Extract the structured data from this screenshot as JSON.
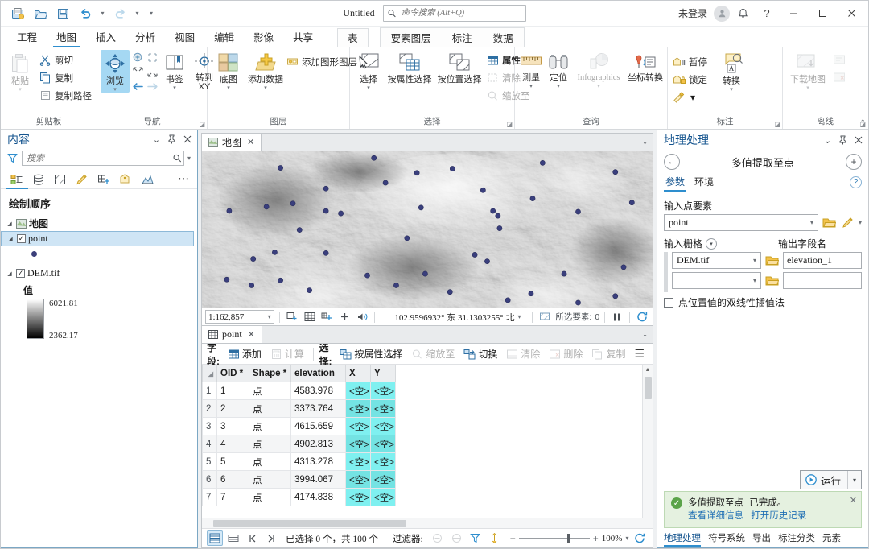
{
  "titlebar": {
    "project_title": "Untitled",
    "search_placeholder": "命令搜索 (Alt+Q)",
    "signin": "未登录",
    "qat": [
      "new-project-icon",
      "open-project-icon",
      "save-project-icon",
      "undo-icon",
      "redo-icon",
      "customize-qat-icon"
    ]
  },
  "ribbon_tabs": {
    "items": [
      {
        "label": "工程"
      },
      {
        "label": "地图"
      },
      {
        "label": "插入"
      },
      {
        "label": "分析"
      },
      {
        "label": "视图"
      },
      {
        "label": "编辑"
      },
      {
        "label": "影像"
      },
      {
        "label": "共享"
      }
    ],
    "active_index": 1,
    "contextual": [
      {
        "label": "表"
      },
      {
        "label": "要素图层"
      },
      {
        "label": "标注"
      },
      {
        "label": "数据"
      }
    ]
  },
  "ribbon": {
    "groups": [
      {
        "name": "剪贴板",
        "big": [
          {
            "label": "粘贴",
            "dropdown": true,
            "disabled": true
          }
        ],
        "small": [
          {
            "label": "剪切",
            "icon": "scissors-icon"
          },
          {
            "label": "复制",
            "icon": "copy-icon"
          },
          {
            "label": "复制路径",
            "icon": "copy-path-icon"
          }
        ]
      },
      {
        "name": "导航",
        "big": [
          {
            "label": "浏览",
            "dropdown": true,
            "selected": true
          },
          {
            "label": "书签",
            "dropdown": true
          },
          {
            "label": "转到",
            "label2": "XY"
          }
        ],
        "launcher": true
      },
      {
        "name": "图层",
        "big": [
          {
            "label": "底图",
            "dropdown": true
          },
          {
            "label": "添加数据",
            "dropdown": true
          }
        ],
        "small": [
          {
            "label": "添加图形图层",
            "icon": "graphics-layer-icon"
          }
        ]
      },
      {
        "name": "选择",
        "big": [
          {
            "label": "选择",
            "dropdown": true
          },
          {
            "label": "按属性选择"
          },
          {
            "label": "按位置选择"
          }
        ],
        "small": [
          {
            "label": "属性",
            "icon": "attributes-icon",
            "bold": true
          },
          {
            "label": "清除",
            "icon": "clear-selection-icon",
            "disabled": true
          },
          {
            "label": "缩放至",
            "icon": "zoom-to-selection-icon",
            "disabled": true
          }
        ],
        "launcher": true
      },
      {
        "name": "查询",
        "big": [
          {
            "label": "测量",
            "dropdown": true
          },
          {
            "label": "定位",
            "dropdown": true
          },
          {
            "label": "Infographics",
            "dropdown": true,
            "disabled": true
          },
          {
            "label": "坐标转换"
          }
        ]
      },
      {
        "name": "标注",
        "big": [
          {
            "label": "转换",
            "dropdown": true
          }
        ],
        "small": [
          {
            "label": "暂停",
            "icon": "pause-labeling-icon"
          },
          {
            "label": "锁定",
            "icon": "lock-labeling-icon"
          },
          {
            "label": "",
            "icon": "more-labeling-icon"
          }
        ],
        "launcher": true
      },
      {
        "name": "离线",
        "big": [
          {
            "label": "下载地图",
            "dropdown": true,
            "disabled": true
          }
        ],
        "launcher": true
      }
    ]
  },
  "contents": {
    "title": "内容",
    "search_placeholder": "搜索",
    "tabs": [
      "list-by-drawing-order-icon",
      "list-by-data-source-icon",
      "list-by-selection-icon",
      "list-by-editing-icon",
      "list-by-snapping-icon",
      "list-by-labeling-icon",
      "list-by-diagram-icon"
    ],
    "active_tab": 0,
    "heading": "绘制顺序",
    "tree": {
      "map_label": "地图",
      "layers": [
        {
          "label": "point",
          "checked": true,
          "selected": true,
          "symbol": "point-marker"
        },
        {
          "label": "DEM.tif",
          "checked": true,
          "legend_title": "值",
          "ramp_max": "6021.81",
          "ramp_min": "2362.17"
        }
      ]
    }
  },
  "mapview": {
    "tab_label": "地图",
    "status": {
      "scale": "1:162,857",
      "coordinates": "102.9596932° 东  31.1303255° 北",
      "selected_features_label": "所选要素:",
      "selected_features_count": "0"
    },
    "points_color": "#3a3f7d",
    "toolbar_icons": [
      "select-all-icon",
      "grid-icon",
      "snapping-icon",
      "add-icon",
      "audio-icon"
    ]
  },
  "table": {
    "tab_label": "point",
    "toolbar": {
      "fields_label": "字段:",
      "add_label": "添加",
      "calculate_label": "计算",
      "selection_label": "选择:",
      "select_by_attributes_label": "按属性选择",
      "zoom_to_label": "缩放至",
      "switch_label": "切换",
      "clear_label": "清除",
      "delete_label": "删除",
      "copy_label": "复制"
    },
    "columns": [
      "OID *",
      "Shape *",
      "elevation",
      "X",
      "Y"
    ],
    "rows": [
      {
        "n": "1",
        "oid": "1",
        "shape": "点",
        "elevation": "4583.978",
        "x": "<空>",
        "y": "<空>"
      },
      {
        "n": "2",
        "oid": "2",
        "shape": "点",
        "elevation": "3373.764",
        "x": "<空>",
        "y": "<空>"
      },
      {
        "n": "3",
        "oid": "3",
        "shape": "点",
        "elevation": "4615.659",
        "x": "<空>",
        "y": "<空>"
      },
      {
        "n": "4",
        "oid": "4",
        "shape": "点",
        "elevation": "4902.813",
        "x": "<空>",
        "y": "<空>"
      },
      {
        "n": "5",
        "oid": "5",
        "shape": "点",
        "elevation": "4313.278",
        "x": "<空>",
        "y": "<空>"
      },
      {
        "n": "6",
        "oid": "6",
        "shape": "点",
        "elevation": "3994.067",
        "x": "<空>",
        "y": "<空>"
      },
      {
        "n": "7",
        "oid": "7",
        "shape": "点",
        "elevation": "4174.838",
        "x": "<空>",
        "y": "<空>"
      }
    ],
    "status": {
      "selected_text": "已选择 0 个，共 100 个",
      "filter_label": "过滤器:",
      "zoom_value": "100%"
    }
  },
  "geoprocessing": {
    "title": "地理处理",
    "tool_name": "多值提取至点",
    "tabs": [
      "参数",
      "环境"
    ],
    "active_tab": 0,
    "fields": {
      "input_point_features_label": "输入点要素",
      "input_point_features_value": "point",
      "input_rasters_label": "输入栅格",
      "output_field_name_label": "输出字段名",
      "raster_rows": [
        {
          "raster": "DEM.tif",
          "field": "elevation_1"
        },
        {
          "raster": "",
          "field": ""
        }
      ],
      "bilinear_label": "点位置值的双线性插值法",
      "bilinear_checked": false
    },
    "run_label": "运行",
    "message": {
      "tool": "多值提取至点",
      "status": "已完成。",
      "link_details": "查看详细信息",
      "link_history": "打开历史记录"
    },
    "bottom_tabs": [
      "地理处理",
      "符号系统",
      "导出",
      "标注分类",
      "元素"
    ],
    "bottom_active": 0
  }
}
